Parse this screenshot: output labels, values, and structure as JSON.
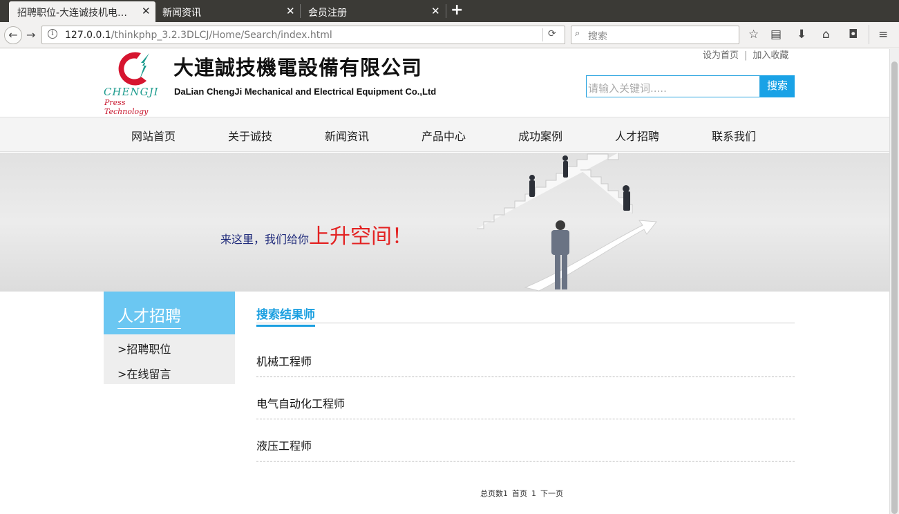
{
  "browser": {
    "tabs": [
      {
        "title": "招聘职位-大连诚技机电…",
        "active": true
      },
      {
        "title": "新闻资讯",
        "active": false
      },
      {
        "title": "会员注册",
        "active": false
      }
    ],
    "url_host": "127.0.0.1",
    "url_path": "/thinkphp_3.2.3DLCJ/Home/Search/index.html",
    "search_placeholder": "搜索"
  },
  "header": {
    "logo_word": "CHENGJI",
    "logo_tagline": "Press Technology",
    "company_cn": "大連誠技機電設備有限公司",
    "company_en": "DaLian ChengJi Mechanical and Electrical Equipment Co.,Ltd",
    "top_links": [
      "设为首页",
      "加入收藏"
    ],
    "search_placeholder": "请输入关键词.....",
    "search_button": "搜索"
  },
  "nav": [
    "网站首页",
    "关于诚技",
    "新闻资讯",
    "产品中心",
    "成功案例",
    "人才招聘",
    "联系我们"
  ],
  "banner": {
    "text_small": "来这里，我们给你",
    "text_big": "上升空间！"
  },
  "sidebar": {
    "title": "人才招聘",
    "items": [
      ">招聘职位",
      ">在线留言"
    ]
  },
  "content": {
    "title": "搜索结果师",
    "jobs": [
      "机械工程师",
      "电气自动化工程师",
      "液压工程师"
    ]
  },
  "pager": {
    "total": "总页数1",
    "first": "首页",
    "current": "1",
    "next": "下一页"
  },
  "colors": {
    "accent": "#1aa2e6",
    "sidebar_head": "#6bc7f2",
    "banner_slogan_red": "#e32222"
  }
}
